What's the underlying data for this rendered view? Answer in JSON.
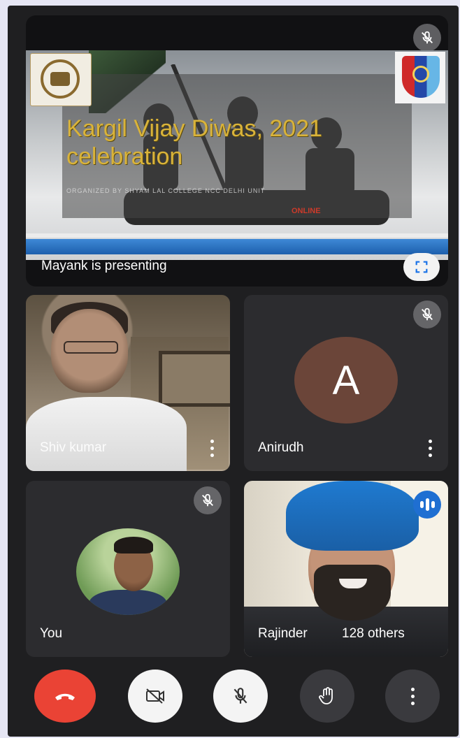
{
  "presentation": {
    "presenter_label": "Mayank  is presenting",
    "slide": {
      "title_line1": "Kargil Vijay Diwas, 2021",
      "title_line2": "celebration",
      "subtitle": "ORGANIZED BY SHYAM LAL COLLEGE NCC DELHI UNIT",
      "online_label": "ONLINE"
    }
  },
  "participants": {
    "shiv": {
      "name": "Shiv kumar"
    },
    "anirudh": {
      "name": "Anirudh",
      "initial": "A"
    },
    "you": {
      "name": "You"
    },
    "rajinder": {
      "name": "Rajinder",
      "others": "128 others"
    }
  },
  "controls": {
    "end_call": {
      "icon": "phone-hangup-icon",
      "color": "#ea4335"
    },
    "camera": {
      "icon": "camera-off-icon"
    },
    "mic": {
      "icon": "mic-off-icon"
    },
    "raise_hand": {
      "icon": "hand-icon"
    },
    "more": {
      "icon": "more-vert-icon"
    }
  },
  "colors": {
    "background": "#1f1f21",
    "tile": "#2c2c2f",
    "speaking": "#1f6fd2",
    "avatar_a": "#6b4539"
  }
}
